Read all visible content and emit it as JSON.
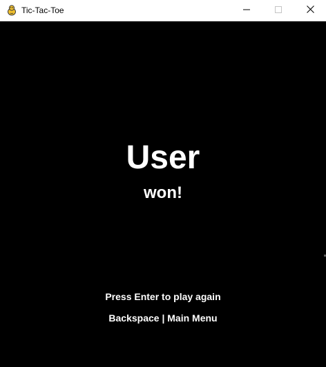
{
  "window": {
    "title": "Tic-Tac-Toe",
    "app_icon": "pygame-snake-icon",
    "controls": {
      "minimize_icon": "minimize-icon",
      "maximize_icon": "maximize-icon",
      "close_icon": "close-icon"
    }
  },
  "result": {
    "winner": "User",
    "suffix": "won!"
  },
  "instructions": {
    "play_again": "Press Enter to play again",
    "main_menu": "Backspace | Main Menu"
  },
  "colors": {
    "background": "#000000",
    "text": "#ffffff",
    "titlebar": "#ffffff",
    "icon_yellow": "#f2c12e",
    "icon_dark": "#3a3a3a"
  }
}
